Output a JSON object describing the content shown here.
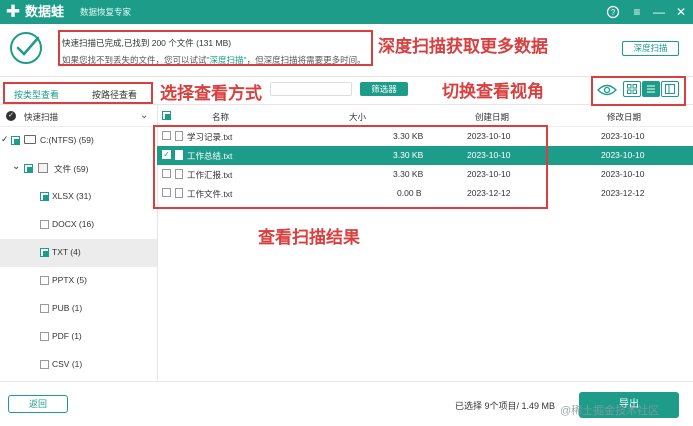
{
  "app": {
    "name": "数据蛙",
    "slogan": "数据恢复专家",
    "window_icons": [
      "help-circle-icon",
      "menu-icon",
      "minimize-icon",
      "close-icon"
    ]
  },
  "status": {
    "line1": "快速扫描已完成,已找到 200 个文件 (131 MB)",
    "line2_prefix": "如果您找不到丢失的文件，您可以试试",
    "line2_link": "\"深度扫描\"",
    "line2_suffix": "，但深度扫描将需要更多时间。",
    "deep_scan_button": "深度扫描"
  },
  "view_modes": {
    "by_type": "按类型查看",
    "by_path": "按路径查看"
  },
  "toolbar": {
    "filter_button": "筛选器",
    "view_buttons": [
      "grid-view-icon",
      "list-view-icon",
      "preview-panel-icon"
    ]
  },
  "sidebar": {
    "header": "快速扫描",
    "tree": [
      {
        "label": "C:(NTFS) (59)",
        "level": 0
      },
      {
        "label": "文件 (59)",
        "level": 1
      },
      {
        "label": "XLSX (31)",
        "level": 2
      },
      {
        "label": "DOCX (16)",
        "level": 2
      },
      {
        "label": "TXT (4)",
        "level": 2
      },
      {
        "label": "PPTX (5)",
        "level": 2
      },
      {
        "label": "PUB (1)",
        "level": 2
      },
      {
        "label": "PDF (1)",
        "level": 2
      },
      {
        "label": "CSV (1)",
        "level": 2
      }
    ]
  },
  "table": {
    "columns": [
      "名称",
      "大小",
      "创建日期",
      "修改日期"
    ],
    "rows": [
      {
        "name": "学习记录.txt",
        "size": "3.30 KB",
        "created": "2023-10-10",
        "modified": "2023-10-10",
        "checked": false
      },
      {
        "name": "工作总结.txt",
        "size": "3.30 KB",
        "created": "2023-10-10",
        "modified": "2023-10-10",
        "checked": true
      },
      {
        "name": "工作汇报.txt",
        "size": "3.30 KB",
        "created": "2023-10-10",
        "modified": "2023-10-10",
        "checked": false
      },
      {
        "name": "工作文件.txt",
        "size": "0.00  B",
        "created": "2023-12-12",
        "modified": "2023-12-12",
        "checked": false
      }
    ]
  },
  "footer": {
    "back_button": "返回",
    "selected_summary": "已选择 9个项目/ 1.49 MB",
    "export_button": "导出"
  },
  "annotations": {
    "deep_scan": "深度扫描获取更多数据",
    "choose_view": "选择查看方式",
    "switch_view": "切换查看视角",
    "view_results": "查看扫描结果"
  },
  "watermark": "@稀土掘金技术社区",
  "colors": {
    "brand": "#1e9c8a",
    "annotation": "#d84040"
  }
}
